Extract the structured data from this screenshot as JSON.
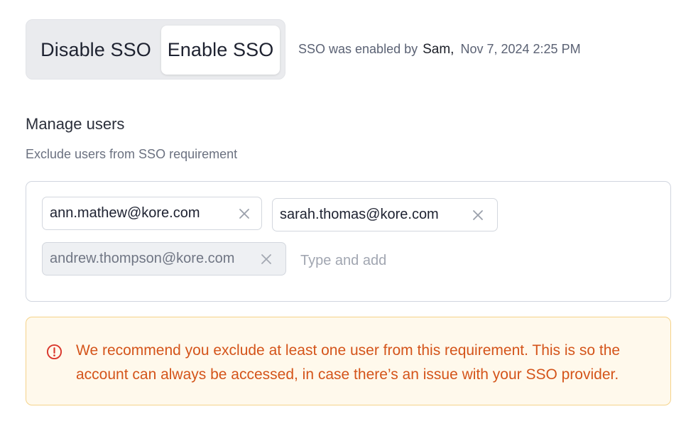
{
  "sso": {
    "disable_label": "Disable SSO",
    "enable_label": "Enable SSO",
    "selected": "enable",
    "status_prefix": "SSO was enabled by",
    "enabled_by": "Sam,",
    "enabled_at": "Nov 7, 2024 2:25 PM"
  },
  "manage_users": {
    "title": "Manage users",
    "subtitle": "Exclude users from SSO requirement",
    "excluded_users": [
      {
        "email": "ann.mathew@kore.com",
        "state": "default"
      },
      {
        "email": "sarah.thomas@kore.com",
        "state": "default"
      },
      {
        "email": "andrew.thompson@kore.com",
        "state": "disabled"
      }
    ],
    "input_placeholder": "Type and add",
    "input_value": ""
  },
  "warning": {
    "icon": "alert-circle-icon",
    "message": "We recommend you exclude at least one user from this requirement. This is so the account can always be accessed, in case there’s an issue with your SSO provider."
  },
  "colors": {
    "warning_text": "#d4541a",
    "warning_bg": "#fff9ec",
    "warning_border": "#f5d38a",
    "toggle_bg": "#eaebee"
  }
}
